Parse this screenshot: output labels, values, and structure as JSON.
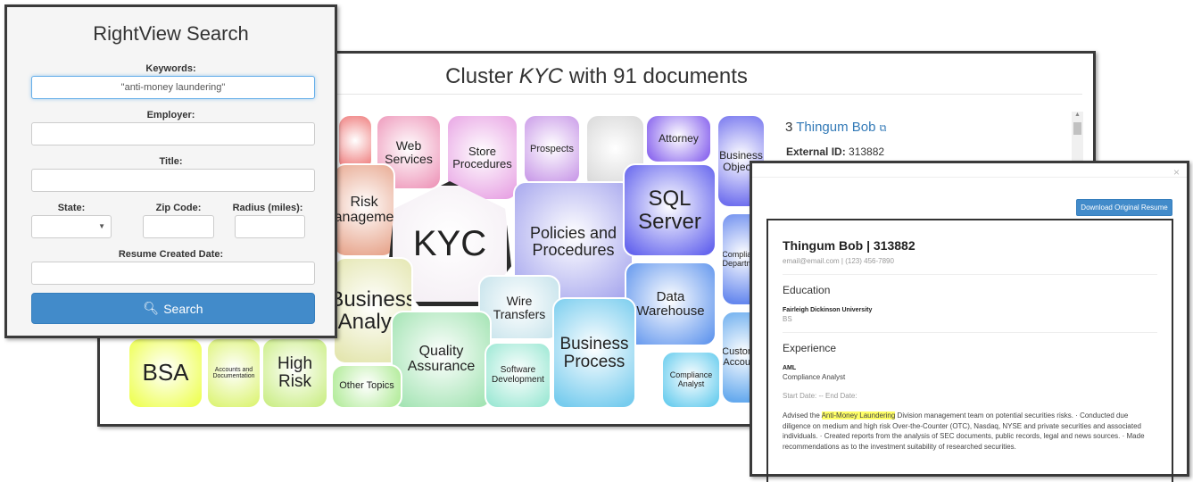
{
  "search": {
    "title": "RightView Search",
    "keywords_label": "Keywords:",
    "keywords_value": "\"anti-money laundering\"",
    "employer_label": "Employer:",
    "title_label": "Title:",
    "state_label": "State:",
    "zip_label": "Zip Code:",
    "radius_label": "Radius (miles):",
    "date_label": "Resume Created Date:",
    "search_button": "Search",
    "search_icon": "magnifier-icon",
    "accent": "#428bca"
  },
  "cluster": {
    "title_prefix": "Cluster",
    "title_name": "KYC",
    "title_suffix": "with 91 documents",
    "cells": [
      {
        "label": "",
        "color": "#ee7777"
      },
      {
        "label": "Web Services",
        "color": "#ee99bb"
      },
      {
        "label": "Store Procedures",
        "color": "#e8a4e4"
      },
      {
        "label": "Prospects",
        "color": "#c99ae8"
      },
      {
        "label": "",
        "color": "#d8d8d8"
      },
      {
        "label": "Attorney",
        "color": "#8a66ee"
      },
      {
        "label": "Business Objects",
        "color": "#7070ee"
      },
      {
        "label": "Risk Management",
        "color": "#e8a890"
      },
      {
        "label": "KYC",
        "color": "#f4eef4"
      },
      {
        "label": "Policies and Procedures",
        "color": "#a8a8ee"
      },
      {
        "label": "SQL Server",
        "color": "#6666ee"
      },
      {
        "label": "Compliance Department",
        "color": "#6688ee"
      },
      {
        "label": "Business Analyst",
        "color": "#e4e6b0"
      },
      {
        "label": "Wire Transfers",
        "color": "#c8e4ec"
      },
      {
        "label": "Data Warehouse",
        "color": "#6699ee"
      },
      {
        "label": "Quality Assurance",
        "color": "#a4e4b4"
      },
      {
        "label": "Business Process",
        "color": "#77ccee"
      },
      {
        "label": "Customer Accounts",
        "color": "#66aaee"
      },
      {
        "label": "BSA",
        "color": "#eeff55"
      },
      {
        "label": "Accounts and Documentation",
        "color": "#ddf477"
      },
      {
        "label": "High Risk",
        "color": "#ccee88"
      },
      {
        "label": "Other Topics",
        "color": "#b4ec9c"
      },
      {
        "label": "Software Development",
        "color": "#9ce8d4"
      },
      {
        "label": "Compliance Analyst",
        "color": "#66ccee"
      }
    ],
    "detail": {
      "rank": "3",
      "name": "Thingum Bob",
      "external_label": "External ID:",
      "external_id": "313882"
    }
  },
  "resume": {
    "close": "×",
    "download_button": "Download Original Resume",
    "header": "Thingum Bob | 313882",
    "contact": "email@email.com | (123) 456-7890",
    "education_heading": "Education",
    "school": "Fairleigh Dickinson University",
    "degree": "BS",
    "experience_heading": "Experience",
    "employer": "AML",
    "job_title": "Compliance Analyst",
    "dates": "Start Date: -- End Date:",
    "desc_pre": "Advised the ",
    "desc_highlight": "Anti-Money Laundering",
    "desc_post": " Division management team on potential securities risks. · Conducted due diligence on medium and high risk Over-the-Counter (OTC), Nasdaq, NYSE and private securities and associated individuals. · Created reports from the analysis of SEC documents, public records, legal and news sources. · Made recommendations as to the investment suitability of researched securities."
  }
}
